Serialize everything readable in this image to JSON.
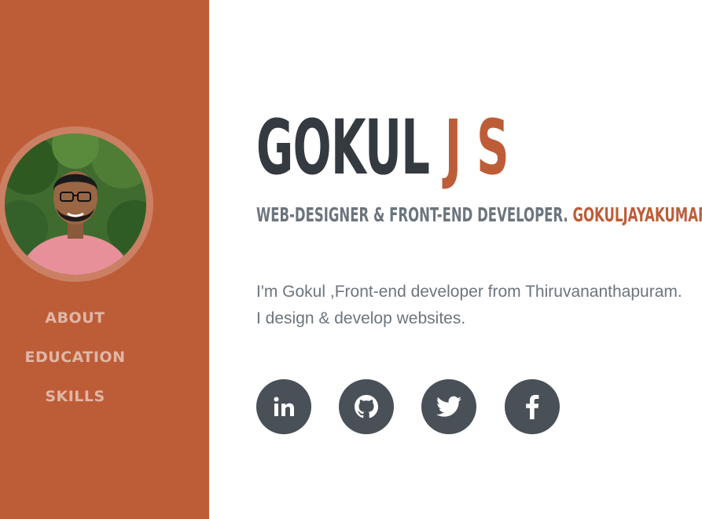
{
  "sidebar": {
    "avatar_alt": "Profile photo of Gokul",
    "nav": [
      {
        "label": "ABOUT"
      },
      {
        "label": "EDUCATION"
      },
      {
        "label": "SKILLS"
      }
    ]
  },
  "hero": {
    "first_name": "GOKUL",
    "last_name": "J S",
    "role": "WEB-DESIGNER & FRONT-END DEVELOPER.",
    "email": "GOKULJAYAKUMARTVM",
    "intro_line1": "I'm Gokul ,Front-end developer from Thiruvananthapuram.",
    "intro_line2": "I design & develop websites."
  },
  "social": [
    {
      "icon": "linkedin-icon"
    },
    {
      "icon": "github-icon"
    },
    {
      "icon": "twitter-icon"
    },
    {
      "icon": "facebook-icon"
    }
  ],
  "colors": {
    "primary": "#bd5d38",
    "dark": "#343a40",
    "muted": "#6c757d",
    "social_bg": "#495057"
  }
}
